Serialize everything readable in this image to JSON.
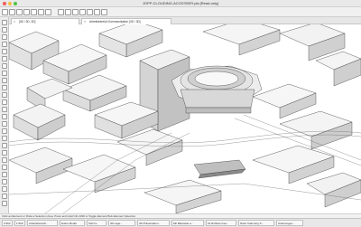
{
  "window": {
    "title": "JOPP-CLOUDING-ACCESSER.pla [Read-only]",
    "traffic_colors": [
      "#f45d55",
      "#f7bd3b",
      "#4ec441"
    ]
  },
  "toolbar": {
    "icon_names": [
      "arrow-select-icon",
      "marquee-icon",
      "magic-wand-icon",
      "grid-icon",
      "layer-icon",
      "undo-icon",
      "redo-icon",
      "pan-icon",
      "zoom-icon",
      "orbit-icon",
      "3d-view-icon",
      "fit-icon",
      "settings-icon",
      "mesh-icon"
    ]
  },
  "tabs": [
    {
      "label": "[3D / 3D, 3D]"
    },
    {
      "label": "Arbeitsbereich Kommunikation [3D / 3D]"
    }
  ],
  "canvas": {
    "accent": "#3a3a3a",
    "shade": "#cfcfcf"
  },
  "statusbar": {
    "text": "Click an Element or Draw a Selection Area. Press and Hold Ctrl+Shift to Toggle Element/Sub-Element Selection."
  },
  "bottombar": {
    "cells": [
      "3:362",
      "1:500",
      "Arbeitsbereich...",
      "Entire Model",
      "Schirm",
      "3D Lage...",
      "3D Präsentation...",
      "Mit Baustelle a...",
      "01 Rohbau Ges...",
      "Nach Änderung S...",
      "Änderungen..."
    ]
  }
}
